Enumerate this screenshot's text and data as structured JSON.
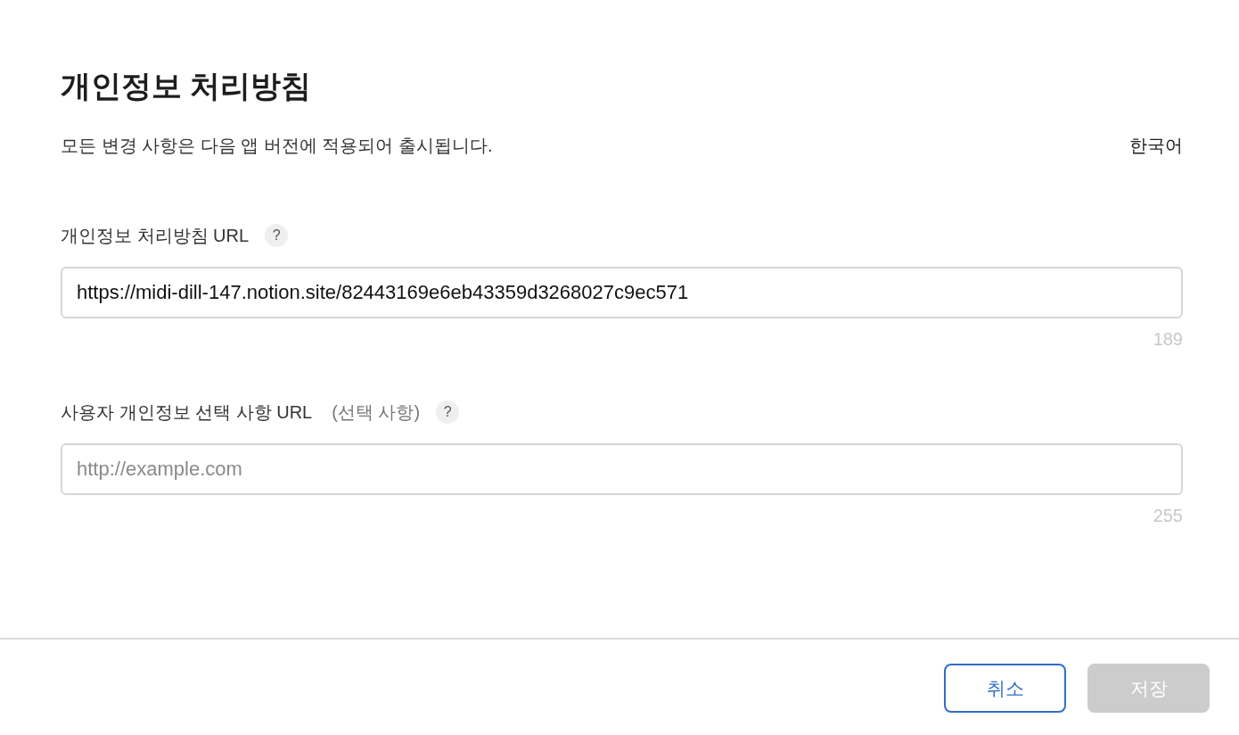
{
  "title": "개인정보 처리방침",
  "subtitle": "모든 변경 사항은 다음 앱 버전에 적용되어 출시됩니다.",
  "language": "한국어",
  "fields": [
    {
      "label": "개인정보 처리방침 URL",
      "help": "?",
      "value": "https://midi-dill-147.notion.site/82443169e6eb43359d3268027c9ec571",
      "counter": "189"
    },
    {
      "label": "사용자 개인정보 선택 사항 URL",
      "optional_note": "(선택 사항)",
      "help": "?",
      "placeholder": "http://example.com",
      "counter": "255"
    }
  ],
  "buttons": [
    {
      "label": "취소",
      "kind": "secondary",
      "disabled": false
    },
    {
      "label": "저장",
      "kind": "primary",
      "disabled": true
    }
  ]
}
